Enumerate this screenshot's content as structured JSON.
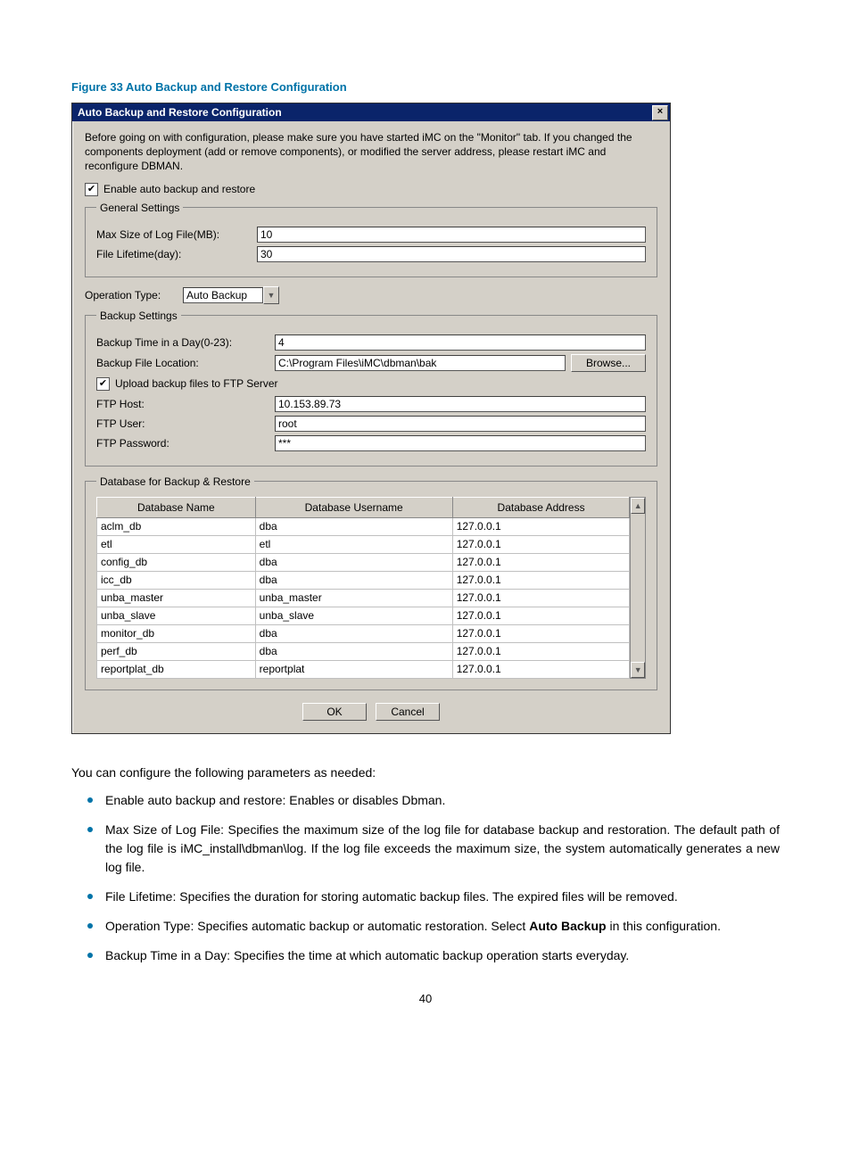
{
  "caption": "Figure 33 Auto Backup and Restore Configuration",
  "dialog": {
    "title": "Auto Backup and Restore Configuration",
    "close_glyph": "×",
    "intro": "Before going on with configuration, please make sure you have started iMC on the \"Monitor\" tab. If you changed the components deployment (add or remove components), or modified the server address, please restart iMC and reconfigure DBMAN.",
    "enable_check_mark": "✔",
    "enable_label": "Enable auto backup and restore",
    "general_legend": "General Settings",
    "max_log_label": "Max Size of Log File(MB):",
    "max_log_value": "10",
    "lifetime_label": "File Lifetime(day):",
    "lifetime_value": "30",
    "optype_label": "Operation Type:",
    "optype_value": "Auto Backup",
    "dropdown_glyph": "▼",
    "backup_legend": "Backup Settings",
    "backup_time_label": "Backup Time in a Day(0-23):",
    "backup_time_value": "4",
    "backup_loc_label": "Backup File Location:",
    "backup_loc_value": "C:\\Program Files\\iMC\\dbman\\bak",
    "browse_label": "Browse...",
    "upload_check_mark": "✔",
    "upload_label": "Upload backup files to FTP Server",
    "ftp_host_label": "FTP Host:",
    "ftp_host_value": "10.153.89.73",
    "ftp_user_label": "FTP User:",
    "ftp_user_value": "root",
    "ftp_pass_label": "FTP Password:",
    "ftp_pass_value": "***",
    "db_legend": "Database for Backup & Restore",
    "col_name": "Database Name",
    "col_user": "Database Username",
    "col_addr": "Database Address",
    "rows": [
      {
        "n": "aclm_db",
        "u": "dba",
        "a": "127.0.0.1"
      },
      {
        "n": "etl",
        "u": "etl",
        "a": "127.0.0.1"
      },
      {
        "n": "config_db",
        "u": "dba",
        "a": "127.0.0.1"
      },
      {
        "n": "icc_db",
        "u": "dba",
        "a": "127.0.0.1"
      },
      {
        "n": "unba_master",
        "u": "unba_master",
        "a": "127.0.0.1"
      },
      {
        "n": "unba_slave",
        "u": "unba_slave",
        "a": "127.0.0.1"
      },
      {
        "n": "monitor_db",
        "u": "dba",
        "a": "127.0.0.1"
      },
      {
        "n": "perf_db",
        "u": "dba",
        "a": "127.0.0.1"
      },
      {
        "n": "reportplat_db",
        "u": "reportplat",
        "a": "127.0.0.1"
      }
    ],
    "scroll_up": "▲",
    "scroll_down": "▼",
    "ok_label": "OK",
    "cancel_label": "Cancel"
  },
  "para_intro": "You can configure the following parameters as needed:",
  "bullets": {
    "b0": "Enable auto backup and restore: Enables or disables Dbman.",
    "b1": "Max Size of Log File: Specifies the maximum size of the log file for database backup and restoration. The default path of the log file is iMC_install\\dbman\\log. If the log file exceeds the maximum size, the system automatically generates a new log file.",
    "b2": "File Lifetime: Specifies the duration for storing automatic backup files. The expired files will be removed.",
    "b3_pre": "Operation Type: Specifies automatic backup or automatic restoration. Select ",
    "b3_bold": "Auto Backup",
    "b3_post": " in this configuration.",
    "b4": "Backup Time in a Day: Specifies the time at which automatic backup operation starts everyday."
  },
  "page_number": "40"
}
